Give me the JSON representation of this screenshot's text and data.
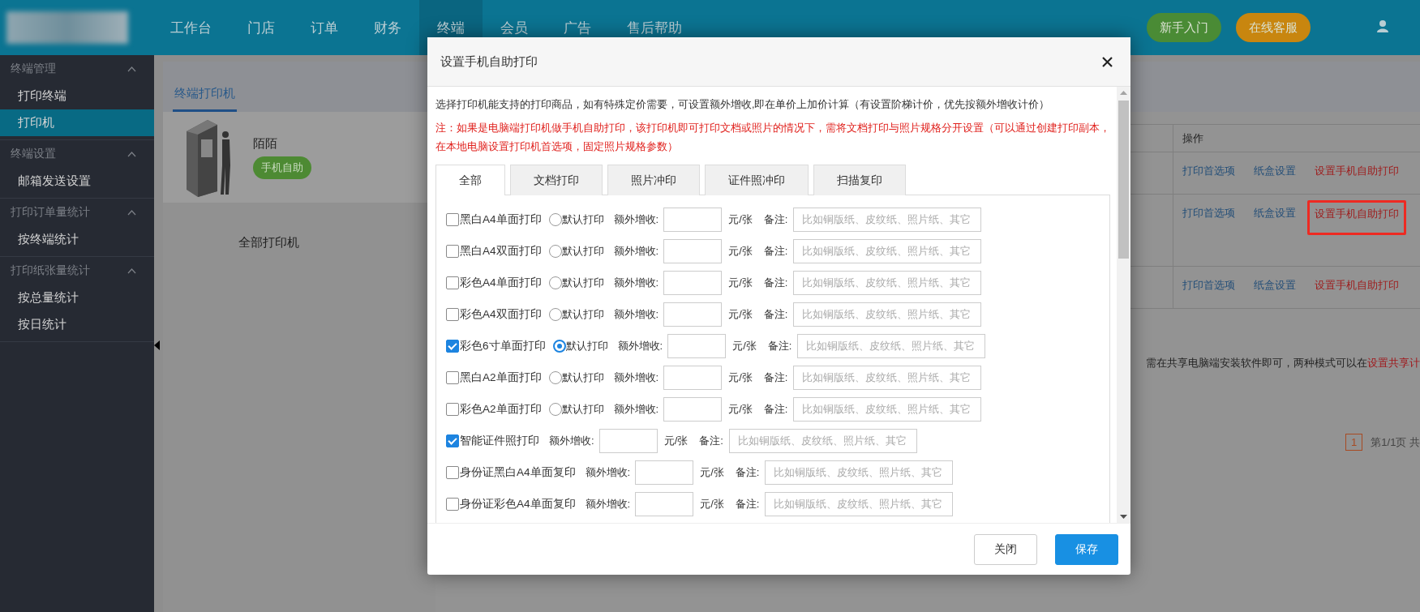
{
  "top_nav": {
    "items": [
      {
        "label": "工作台",
        "selected": false
      },
      {
        "label": "门店",
        "selected": false
      },
      {
        "label": "订单",
        "selected": false
      },
      {
        "label": "财务",
        "selected": false
      },
      {
        "label": "终端",
        "selected": true
      },
      {
        "label": "会员",
        "selected": false
      },
      {
        "label": "广告",
        "selected": false
      },
      {
        "label": "售后帮助",
        "selected": false
      }
    ],
    "buttons": [
      {
        "label": "新手入门",
        "kind": "guide"
      },
      {
        "label": "在线客服",
        "kind": "service"
      }
    ]
  },
  "sidebar": {
    "groups": [
      {
        "title": "终端管理",
        "expanded": true,
        "items": [
          {
            "label": "打印终端",
            "selected": false
          },
          {
            "label": "打印机",
            "selected": true
          }
        ]
      },
      {
        "title": "终端设置",
        "expanded": true,
        "items": [
          {
            "label": "邮箱发送设置",
            "selected": false
          }
        ]
      },
      {
        "title": "打印订单量统计",
        "expanded": true,
        "items": [
          {
            "label": "按终端统计",
            "selected": false
          }
        ]
      },
      {
        "title": "打印纸张量统计",
        "expanded": true,
        "items": [
          {
            "label": "按总量统计",
            "selected": false
          },
          {
            "label": "按日统计",
            "selected": false
          }
        ]
      }
    ]
  },
  "page": {
    "tabs": [
      {
        "label": "终端打印机",
        "selected": true
      }
    ],
    "printer": {
      "name": "陌陌",
      "badge": "手机自助"
    },
    "all_printers": "全部打印机",
    "table": {
      "columns": [
        "操作"
      ],
      "rows": [
        {
          "actions": [
            "打印首选项",
            "纸盒设置",
            "设置手机自助打印"
          ],
          "highlighted": false
        },
        {
          "actions": [
            "打印首选项",
            "纸盒设置",
            "设置手机自助打印"
          ],
          "highlighted": true
        },
        {
          "actions": [
            "打印首选项",
            "纸盒设置",
            "设置手机自助打印"
          ],
          "highlighted": false
        }
      ]
    },
    "notice": {
      "text": "需在共享电脑端安装软件即可，两种模式可以在",
      "link": "设置共享计"
    },
    "pagination": {
      "pages": [
        {
          "label": "1",
          "selected": true
        }
      ],
      "summary": "第1/1页 共"
    }
  },
  "dialog": {
    "title": "设置手机自助打印",
    "info": "选择打印机能支持的打印商品，如有特殊定价需要，可设置额外增收,即在单价上加价计算（有设置阶梯计价，优先按额外增收计价）",
    "note": "注：如果是电脑端打印机做手机自助打印，该打印机即可打印文档或照片的情况下，需将文档打印与照片规格分开设置（可以通过创建打印副本，在本地电脑设置打印机首选项，固定照片规格参数）",
    "tabs": [
      {
        "label": "全部",
        "selected": true
      },
      {
        "label": "文档打印",
        "selected": false
      },
      {
        "label": "照片冲印",
        "selected": false
      },
      {
        "label": "证件照冲印",
        "selected": false
      },
      {
        "label": "扫描复印",
        "selected": false
      }
    ],
    "rows": [
      {
        "kind": "with_default",
        "label": "黑白A4单面打印",
        "checked": false,
        "default_label": "默认打印",
        "default_selected": false,
        "surcharge_label": "额外增收:",
        "unit": "元/张",
        "remark_label": "备注:",
        "remark_placeholder": "比如铜版纸、皮纹纸、照片纸、其它"
      },
      {
        "kind": "with_default",
        "label": "黑白A4双面打印",
        "checked": false,
        "default_label": "默认打印",
        "default_selected": false,
        "surcharge_label": "额外增收:",
        "unit": "元/张",
        "remark_label": "备注:",
        "remark_placeholder": "比如铜版纸、皮纹纸、照片纸、其它"
      },
      {
        "kind": "with_default",
        "label": "彩色A4单面打印",
        "checked": false,
        "default_label": "默认打印",
        "default_selected": false,
        "surcharge_label": "额外增收:",
        "unit": "元/张",
        "remark_label": "备注:",
        "remark_placeholder": "比如铜版纸、皮纹纸、照片纸、其它"
      },
      {
        "kind": "with_default",
        "label": "彩色A4双面打印",
        "checked": false,
        "default_label": "默认打印",
        "default_selected": false,
        "surcharge_label": "额外增收:",
        "unit": "元/张",
        "remark_label": "备注:",
        "remark_placeholder": "比如铜版纸、皮纹纸、照片纸、其它"
      },
      {
        "kind": "with_default",
        "label": "彩色6寸单面打印",
        "checked": true,
        "default_label": "默认打印",
        "default_selected": true,
        "surcharge_label": "额外增收:",
        "unit": "元/张",
        "remark_label": "备注:",
        "remark_placeholder": "比如铜版纸、皮纹纸、照片纸、其它"
      },
      {
        "kind": "with_default",
        "label": "黑白A2单面打印",
        "checked": false,
        "default_label": "默认打印",
        "default_selected": false,
        "surcharge_label": "额外增收:",
        "unit": "元/张",
        "remark_label": "备注:",
        "remark_placeholder": "比如铜版纸、皮纹纸、照片纸、其它"
      },
      {
        "kind": "with_default",
        "label": "彩色A2单面打印",
        "checked": false,
        "default_label": "默认打印",
        "default_selected": false,
        "surcharge_label": "额外增收:",
        "unit": "元/张",
        "remark_label": "备注:",
        "remark_placeholder": "比如铜版纸、皮纹纸、照片纸、其它"
      },
      {
        "kind": "simple",
        "label": "智能证件照打印",
        "checked": true,
        "surcharge_label": "额外增收:",
        "unit": "元/张",
        "remark_label": "备注:",
        "remark_placeholder": "比如铜版纸、皮纹纸、照片纸、其它"
      },
      {
        "kind": "simple",
        "label": "身份证黑白A4单面复印",
        "checked": false,
        "surcharge_label": "额外增收:",
        "unit": "元/张",
        "remark_label": "备注:",
        "remark_placeholder": "比如铜版纸、皮纹纸、照片纸、其它"
      },
      {
        "kind": "simple",
        "label": "身份证彩色A4单面复印",
        "checked": false,
        "surcharge_label": "额外增收:",
        "unit": "元/张",
        "remark_label": "备注:",
        "remark_placeholder": "比如铜版纸、皮纹纸、照片纸、其它"
      }
    ],
    "buttons": [
      {
        "label": "关闭",
        "kind": "secondary"
      },
      {
        "label": "保存",
        "kind": "primary"
      }
    ]
  }
}
